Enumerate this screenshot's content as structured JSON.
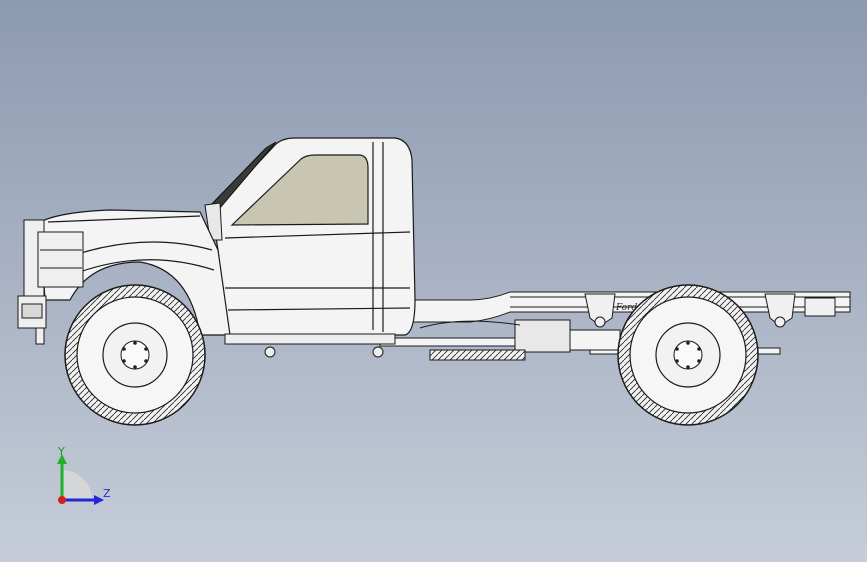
{
  "viewport": {
    "background_top": "#8c9ab0",
    "background_bottom": "#c6cdd9"
  },
  "model": {
    "grille_badge": "Ford",
    "body_color": "#f4f4f4",
    "window_color": "#c8c6b0",
    "line_color": "#1a1a1a"
  },
  "triad": {
    "y_label": "Y",
    "z_label": "Z",
    "y_color": "#22b02a",
    "z_color": "#2424d8",
    "x_color": "#d02020"
  }
}
